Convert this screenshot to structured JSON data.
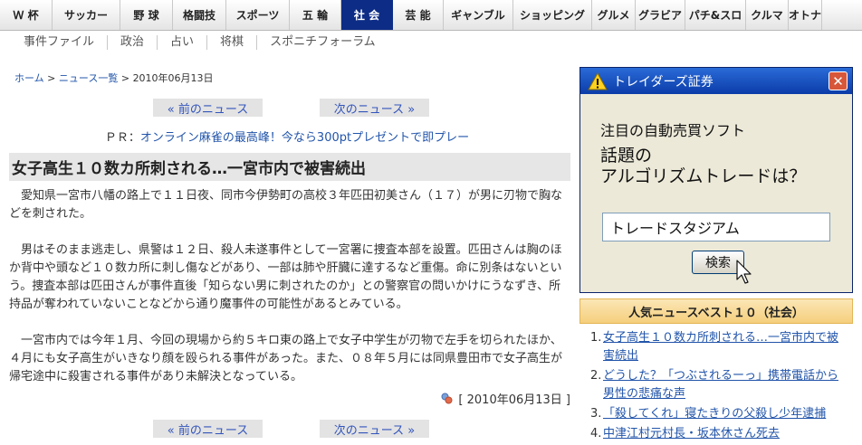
{
  "topnav": [
    {
      "label": "Ｗ 杯",
      "w": 58
    },
    {
      "label": "サッカー",
      "w": 75
    },
    {
      "label": "野 球",
      "w": 58
    },
    {
      "label": "格闘技",
      "w": 59
    },
    {
      "label": "スポーツ",
      "w": 70
    },
    {
      "label": "五 輪",
      "w": 57
    },
    {
      "label": "社 会",
      "w": 57,
      "active": true
    },
    {
      "label": "芸 能",
      "w": 56
    },
    {
      "label": "ギャンブル",
      "w": 77
    },
    {
      "label": "ショッピング",
      "w": 87
    },
    {
      "label": "グルメ",
      "w": 48
    },
    {
      "label": "グラビア",
      "w": 55
    },
    {
      "label": "パチ&スロ",
      "w": 67
    },
    {
      "label": "クルマ",
      "w": 47
    },
    {
      "label": "オトナ",
      "w": 37
    }
  ],
  "subnav": [
    "事件ファイル",
    "政治",
    "占い",
    "将棋",
    "スポニチフォーラム"
  ],
  "breadcrumb": {
    "home": "ホーム",
    "sep1": " > ",
    "list": "ニュース一覧",
    "sep2": " > ",
    "date": "2010年06月13日"
  },
  "pager": {
    "prev": "« 前のニュース",
    "next": "次のニュース »"
  },
  "pr": {
    "prefix": "ＰＲ：",
    "link": "オンライン麻雀の最高峰！今なら300ptプレゼントで即プレー"
  },
  "article": {
    "title": "女子高生１０数カ所刺される…一宮市内で被害続出",
    "paragraphs": [
      "愛知県一宮市八幡の路上で１１日夜、同市今伊勢町の高校３年匹田初美さん（１７）が男に刃物で胸などを刺された。",
      "男はそのまま逃走し、県警は１２日、殺人未遂事件として一宮署に捜査本部を設置。匹田さんは胸のほか背中や頭など１０数カ所に刺し傷などがあり、一部は肺や肝臓に達するなど重傷。命に別条はないという。捜査本部は匹田さんが事件直後「知らない男に刺されたのか」との警察官の問いかけにうなずき、所持品が奪われていないことなどから通り魔事件の可能性があるとみている。",
      "一宮市内では今年１月、今回の現場から約５キロ東の路上で女子中学生が刃物で左手を切られたほか、４月にも女子高生がいきなり顔を殴られる事件があった。また、０８年５月には同県豊田市で女子高生が帰宅途中に殺害される事件があり未解決となっている。"
    ],
    "dateline": "[ 2010年06月13日 ]"
  },
  "ad": {
    "title": "トレイダーズ証券",
    "line1": "注目の自動売買ソフト",
    "line2a": "話題の",
    "line2b": "アルゴリズムトレードは？",
    "field": "トレードスタジアム",
    "button": "検索"
  },
  "ranking": {
    "title": "人気ニュースベスト１０（社会）",
    "items": [
      {
        "n": "1.",
        "t": "女子高生１０数カ所刺される…一宮市内で被害続出"
      },
      {
        "n": "2.",
        "t": "どうした？「つぶされるーっ」携帯電話から男性の悲痛な声"
      },
      {
        "n": "3.",
        "t": "「殺してくれ」寝たきりの父殺し少年逮捕"
      },
      {
        "n": "4.",
        "t": "中津江村元村長・坂本休さん死去"
      }
    ]
  },
  "colors": {
    "nav_active": "#0d2c86",
    "link": "#2255aa",
    "ad_titlebar": "#0b3ca8",
    "rank_header": "#f5cf7d"
  }
}
